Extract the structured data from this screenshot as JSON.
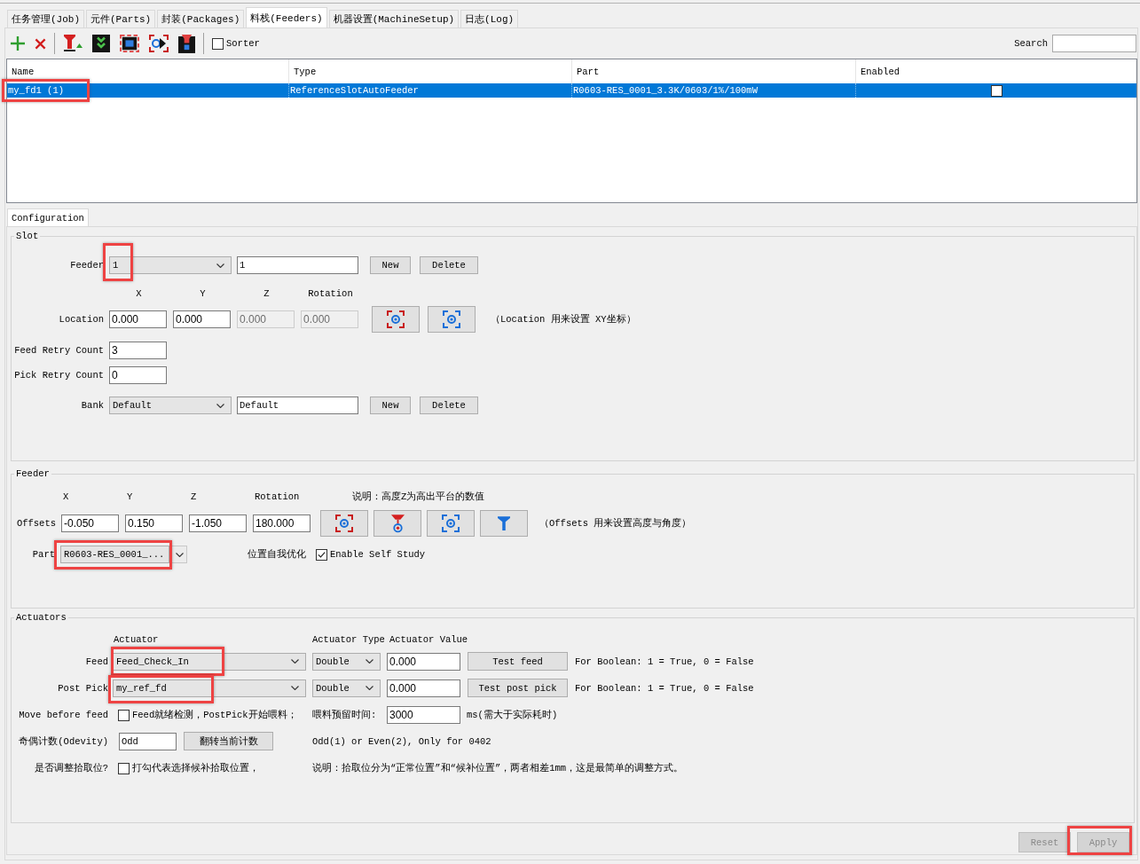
{
  "tabs": [
    {
      "label": "任务管理(Job)",
      "selected": false
    },
    {
      "label": "元件(Parts)",
      "selected": false
    },
    {
      "label": "封装(Packages)",
      "selected": false
    },
    {
      "label": "料栈(Feeders)",
      "selected": true
    },
    {
      "label": "机器设置(MachineSetup)",
      "selected": false
    },
    {
      "label": "日志(Log)",
      "selected": false
    }
  ],
  "toolbar": {
    "sorter": {
      "label": "Sorter",
      "checked": false
    },
    "search": {
      "label": "Search"
    }
  },
  "table": {
    "columns": [
      "Name",
      "Type",
      "Part",
      "Enabled"
    ],
    "rows": [
      {
        "name": "my_fd1 (1)",
        "type": "ReferenceSlotAutoFeeder",
        "part": "R0603-RES_0001_3.3K/0603/1%/100mW",
        "enabled": false,
        "selected": true,
        "highlighted": true
      }
    ]
  },
  "detail_tabs": [
    {
      "label": "Configuration",
      "selected": true
    }
  ],
  "slot": {
    "title": "Slot",
    "feeder": {
      "label": "Feeder",
      "select": "1",
      "highlighted": true,
      "name": "1",
      "buttons": [
        "New",
        "Delete"
      ]
    },
    "axes": [
      "X",
      "Y",
      "Z",
      "Rotation"
    ],
    "location": {
      "label": "Location",
      "fields": [
        {
          "value": "0.000",
          "disabled": false
        },
        {
          "value": "0.000",
          "disabled": false
        },
        {
          "value": "0.000",
          "disabled": true
        },
        {
          "value": "0.000",
          "disabled": true
        }
      ],
      "note": "（Location 用来设置 XY坐标）"
    },
    "retries": [
      {
        "label": "Feed Retry Count",
        "value": "3"
      },
      {
        "label": "Pick Retry Count",
        "value": "0"
      }
    ],
    "bank": {
      "label": "Bank",
      "select": "Default",
      "name": "Default",
      "buttons": [
        "New",
        "Delete"
      ]
    }
  },
  "feeder": {
    "title": "Feeder",
    "axes": [
      "X",
      "Y",
      "Z",
      "Rotation"
    ],
    "note": "说明：高度Z为高出平台的数值",
    "offsets": {
      "label": "Offsets",
      "fields": [
        "-0.050",
        "0.150",
        "-1.050",
        "180.000"
      ],
      "note": "（Offsets 用来设置高度与角度）"
    },
    "part": {
      "label": "Part",
      "select": "R0603-RES_0001_...",
      "highlighted": true
    },
    "self_study": {
      "label": "位置自我优化",
      "checkbox": "Enable Self Study",
      "checked": true
    }
  },
  "actuators": {
    "title": "Actuators",
    "headers": [
      "Actuator",
      "Actuator Type",
      "Actuator Value"
    ],
    "rows": [
      {
        "label": "Feed",
        "actuator": "Feed_Check_In",
        "type": "Double",
        "value": "0.000",
        "button": "Test feed",
        "note": "For Boolean: 1 = True, 0 = False",
        "highlighted": true
      },
      {
        "label": "Post Pick",
        "actuator": "my_ref_fd",
        "type": "Double",
        "value": "0.000",
        "button": "Test post pick",
        "note": "For Boolean: 1 = True, 0 = False",
        "highlighted": true
      }
    ],
    "move_before_feed": {
      "label": "Move before feed",
      "checkbox": "Feed就绪检测，PostPick开始喂料；",
      "checked": false,
      "reserve_label": "喂料预留时间:",
      "reserve_value": "3000",
      "reserve_unit": "ms(需大于实际耗时)"
    },
    "odevity": {
      "label": "奇偶计数(Odevity)",
      "value": "Odd",
      "button": "翻转当前计数",
      "note": "Odd(1) or Even(2), Only for 0402"
    },
    "adjust_pick": {
      "label": "是否调整拾取位?",
      "checkbox": "打勾代表选择候补拾取位置，",
      "checked": false,
      "note": "说明：拾取位分为“正常位置”和“候补位置”，两者相差1mm，这是最简单的调整方式。"
    }
  },
  "footer": {
    "buttons": [
      {
        "label": "Reset",
        "disabled": true,
        "highlighted": false
      },
      {
        "label": "Apply",
        "disabled": true,
        "highlighted": true
      }
    ]
  }
}
